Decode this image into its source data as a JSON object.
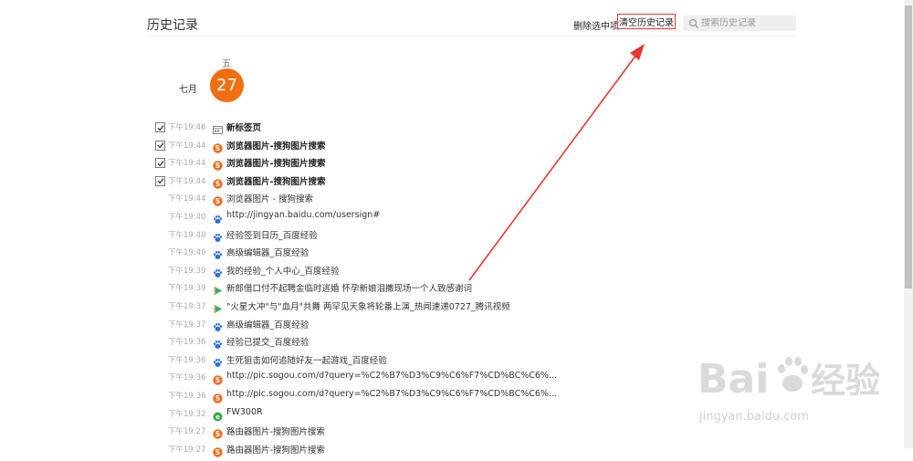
{
  "header": {
    "title": "历史记录",
    "delete_selected": "删除选中项",
    "clear_history": "清空历史记录",
    "search_placeholder": "搜索历史记录"
  },
  "date": {
    "weekday": "五",
    "month": "七月",
    "day": "27"
  },
  "accent_color": "#f06f12",
  "annotation_color": "#e8362e",
  "records": [
    {
      "checked": true,
      "time": "下午19:46",
      "icon": "new-tab-icon",
      "title": "新标签页",
      "bold": true
    },
    {
      "checked": true,
      "time": "下午19:44",
      "icon": "sogou-icon",
      "title": "浏览器图片-搜狗图片搜索",
      "bold": true
    },
    {
      "checked": true,
      "time": "下午19:44",
      "icon": "sogou-icon",
      "title": "浏览器图片-搜狗图片搜索",
      "bold": true
    },
    {
      "checked": true,
      "time": "下午19:44",
      "icon": "sogou-icon",
      "title": "浏览器图片-搜狗图片搜索",
      "bold": true
    },
    {
      "checked": false,
      "time": "下午19:44",
      "icon": "sogou-icon",
      "title": "浏览器图片 - 搜狗搜索",
      "bold": false
    },
    {
      "checked": false,
      "time": "下午19:40",
      "icon": "baidu-paw-icon",
      "title": "http://jingyan.baidu.com/usersign#",
      "bold": false
    },
    {
      "checked": false,
      "time": "下午19:40",
      "icon": "baidu-paw-icon",
      "title": "经验签到日历_百度经验",
      "bold": false
    },
    {
      "checked": false,
      "time": "下午19:40",
      "icon": "baidu-paw-icon",
      "title": "高级编辑器_百度经验",
      "bold": false
    },
    {
      "checked": false,
      "time": "下午19:39",
      "icon": "baidu-paw-icon",
      "title": "我的经验_个人中心_百度经验",
      "bold": false
    },
    {
      "checked": false,
      "time": "下午19:39",
      "icon": "video-play-icon",
      "title": "新郎借口付不起聘金临时逃婚 怀孕新娘泪撒现场一个人致感谢词",
      "bold": false
    },
    {
      "checked": false,
      "time": "下午19:37",
      "icon": "video-play-icon",
      "title": "\"火星大冲\"与\"血月\"共舞 两罕见天象将轮番上演_热闻速递0727_腾讯视频",
      "bold": false
    },
    {
      "checked": false,
      "time": "下午19:37",
      "icon": "baidu-paw-icon",
      "title": "高级编辑器_百度经验",
      "bold": false
    },
    {
      "checked": false,
      "time": "下午19:36",
      "icon": "baidu-paw-icon",
      "title": "经验已提交_百度经验",
      "bold": false
    },
    {
      "checked": false,
      "time": "下午19:36",
      "icon": "baidu-paw-icon",
      "title": "生死狙击如何追随好友一起游戏_百度经验",
      "bold": false
    },
    {
      "checked": false,
      "time": "下午19:36",
      "icon": "sogou-icon",
      "title": "http://pic.sogou.com/d?query=%C2%B7%D3%C9%C6%F7%CD%BC%C6%...",
      "bold": false
    },
    {
      "checked": false,
      "time": "下午19:36",
      "icon": "sogou-icon",
      "title": "http://pic.sogou.com/d?query=%C2%B7%D3%C9%C6%F7%CD%BC%C6%...",
      "bold": false
    },
    {
      "checked": false,
      "time": "下午19:32",
      "icon": "green-globe-icon",
      "title": "FW300R",
      "bold": false
    },
    {
      "checked": false,
      "time": "下午19:27",
      "icon": "sogou-icon",
      "title": "路由器图片-搜狗图片搜索",
      "bold": false
    },
    {
      "checked": false,
      "time": "下午19:27",
      "icon": "sogou-icon",
      "title": "路由器图片-搜狗图片搜索",
      "bold": false
    }
  ],
  "watermark": {
    "main": "Bai经验",
    "sub": "jingyan.baidu.com"
  }
}
